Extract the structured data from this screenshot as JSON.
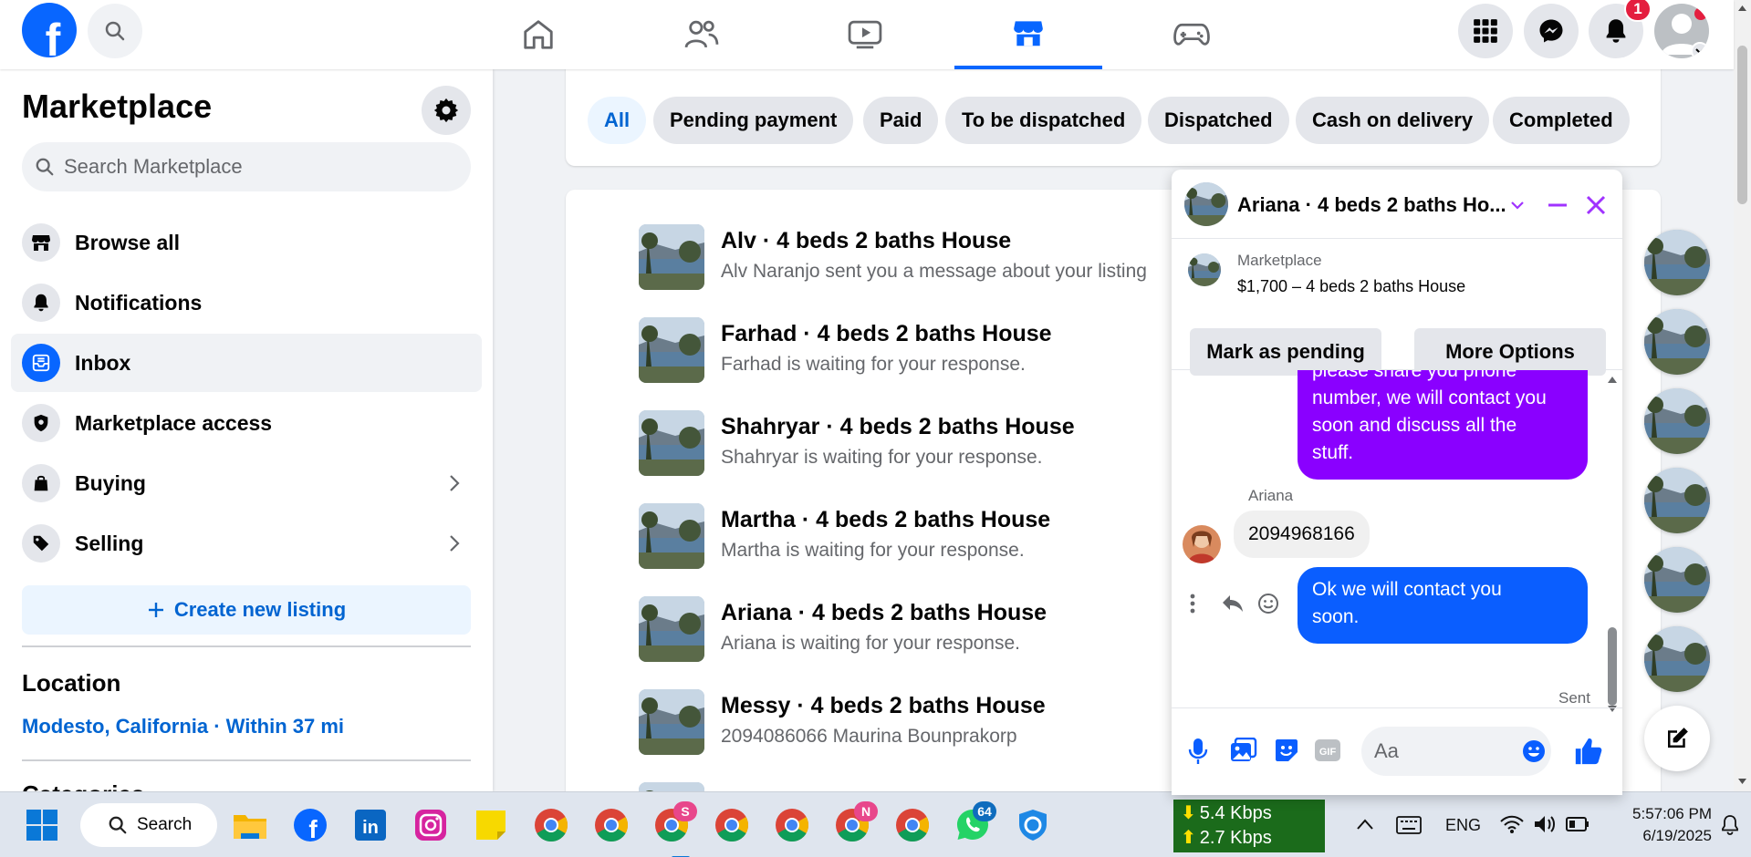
{
  "topbar": {
    "logo_letter": "f",
    "notification_count": "1",
    "nav_tabs": [
      "home",
      "friends",
      "watch",
      "marketplace",
      "gaming"
    ],
    "active_tab": "marketplace",
    "accent": "#0866ff"
  },
  "sidebar": {
    "title": "Marketplace",
    "search_placeholder": "Search Marketplace",
    "items": [
      {
        "label": "Browse all",
        "icon": "storefront-icon"
      },
      {
        "label": "Notifications",
        "icon": "bell-icon"
      },
      {
        "label": "Inbox",
        "icon": "inbox-icon",
        "active": true
      },
      {
        "label": "Marketplace access",
        "icon": "shield-icon"
      },
      {
        "label": "Buying",
        "icon": "shopping-bag-icon"
      },
      {
        "label": "Selling",
        "icon": "tag-icon"
      }
    ],
    "create_label": "Create new listing",
    "location_title": "Location",
    "location_value": "Modesto, California · Within 37 mi",
    "categories_title": "Categories"
  },
  "filters": [
    "All",
    "Pending payment",
    "Paid",
    "To be dispatched",
    "Dispatched",
    "Cash on delivery",
    "Completed"
  ],
  "conversations": [
    {
      "title": "Alv · 4 beds 2 baths House",
      "subtitle": "Alv Naranjo sent you a message about your listing"
    },
    {
      "title": "Farhad · 4 beds 2 baths House",
      "subtitle": "Farhad is waiting for your response."
    },
    {
      "title": "Shahryar · 4 beds 2 baths House",
      "subtitle": "Shahryar is waiting for your response."
    },
    {
      "title": "Martha · 4 beds 2 baths House",
      "subtitle": "Martha is waiting for your response."
    },
    {
      "title": "Ariana · 4 beds 2 baths House",
      "subtitle": "Ariana is waiting for your response."
    },
    {
      "title": "Messy · 4 beds 2 baths House",
      "subtitle": "2094086066 Maurina Bounprakorp"
    }
  ],
  "chat": {
    "title": "Ariana · 4 beds 2 baths Ho...",
    "marketplace_label": "Marketplace",
    "listing_price": "$1,700 – 4 beds 2 baths House",
    "mark_pending_label": "Mark as pending",
    "more_options_label": "More Options",
    "outgoing_1_lines": [
      "please share you phone",
      "number, we will contact you",
      "soon and discuss all the",
      "stuff."
    ],
    "sender_name": "Ariana",
    "incoming_1": "2094968166",
    "outgoing_2_lines": [
      "Ok we will contact you",
      "soon."
    ],
    "status": "Sent",
    "composer_placeholder": "Aa",
    "colors": {
      "outgoing_purple": "#8a00ff",
      "outgoing_blue": "#0a5eff",
      "controls": "#a033ff"
    }
  },
  "taskbar": {
    "search_label": "Search",
    "net_down": "5.4 Kbps",
    "net_up": "2.7 Kbps",
    "language": "ENG",
    "time": "5:57:06 PM",
    "date": "6/19/2025",
    "chrome_badge": "S",
    "chrome_n_badge": "N",
    "whatsapp_badge": "64"
  }
}
